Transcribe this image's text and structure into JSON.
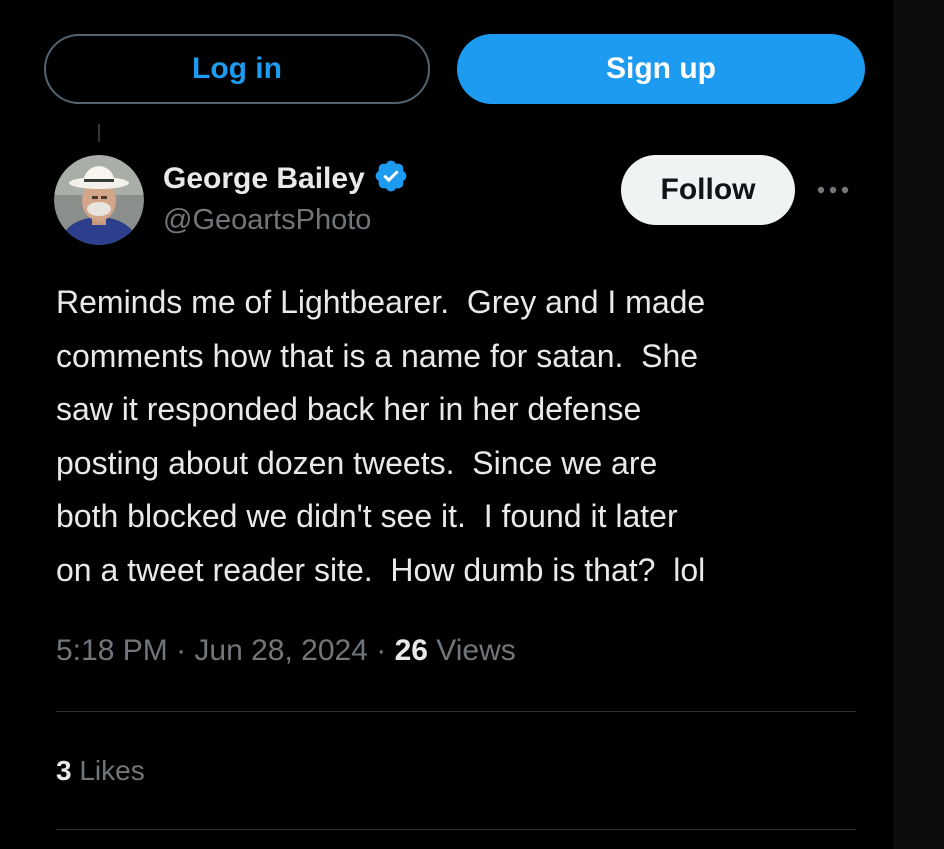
{
  "auth": {
    "login_label": "Log in",
    "signup_label": "Sign up"
  },
  "tweet": {
    "author": {
      "display_name": "George Bailey",
      "handle": "@GeoartsPhoto",
      "verified_icon": "verified-badge-icon",
      "avatar": "avatar"
    },
    "follow_label": "Follow",
    "more_icon": "more-options-icon",
    "text": "Reminds me of Lightbearer.  Grey and I made\ncomments how that is a name for satan.  She\nsaw it responded back her in her defense\nposting about dozen tweets.  Since we are\nboth blocked we didn't see it.  I found it later\non a tweet reader site.  How dumb is that?  lol",
    "time": "5:18 PM",
    "separator": " · ",
    "date": "Jun 28, 2024",
    "views_count": "26",
    "views_label": "Views",
    "likes_count": "3",
    "likes_label": "Likes"
  },
  "colors": {
    "background": "#000000",
    "accent": "#1d9bf0",
    "text_primary": "#e7e9ea",
    "text_secondary": "#71767b",
    "border": "#2f3336",
    "follow_bg": "#eff3f4"
  }
}
